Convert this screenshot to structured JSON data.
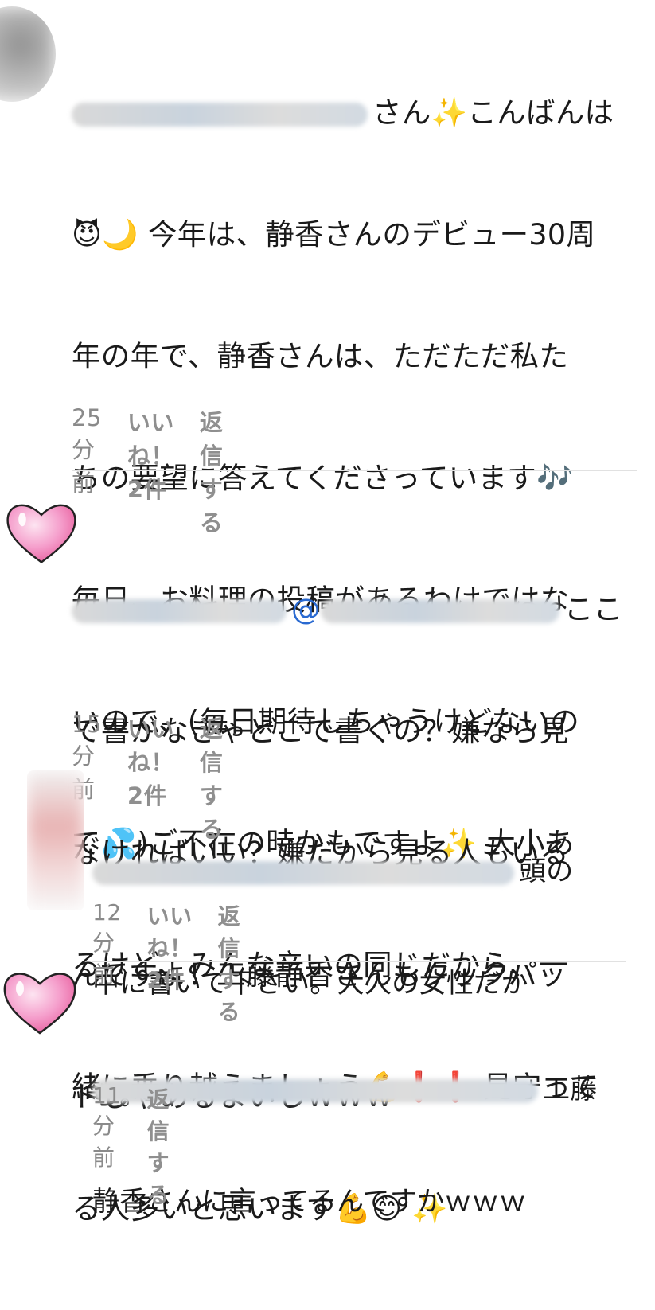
{
  "comments": [
    {
      "text_lines": [
        "さん✨こんばんは",
        "😈🌙 今年は、静香さんのデビュー30周",
        "年の年で、静香さんは、ただただ私た",
        "ちの要望に答えてくださっています🎶",
        "毎日、お料理の投稿があるわけではな",
        "いので、(毎日期待しちゃうけどないの",
        "で💦)ご不在の時かもですよ✨ 大小あ",
        "るけど、みんな辛いの同じだから、一",
        "緒に乗り越えましょう💪❗❗ 見守って",
        "る人多いと思います💪😊 ✨"
      ],
      "time": "25分前",
      "like": "いいね！2件",
      "reply": "返信する"
    },
    {
      "mention": "@",
      "first_line_tail": "ここ",
      "text_lines": [
        "で書かなきゃどこで書くの？嫌なら見",
        "なければいい？嫌だから見る人もいる",
        "んですよ！工藤静香さんもクックパッ",
        "ドじゃあるまいしｗｗｗ"
      ],
      "time": "15分前",
      "like": "いいね！2件",
      "reply": "返信する"
    },
    {
      "first_line_tail": "頭の",
      "text_lines": [
        "中に書いて下さい。大人の女性だか",
        "ら。"
      ],
      "time": "12分前",
      "like": "いいね！2件",
      "reply": "返信する"
    },
    {
      "first_line_tail": "工藤",
      "text_lines": [
        "静香さんに言ってるんですかｗｗｗ"
      ],
      "time": "11分前",
      "reply": "返信する"
    }
  ],
  "colors": {
    "text": "#1a1a1a",
    "meta": "#8a8a8a",
    "heart": "#f28ac0",
    "divider": "#e1e1e1"
  },
  "icons": [
    "heart-avatar-icon",
    "sparkle-icon",
    "moon-icon",
    "devil-icon",
    "music-note-icon",
    "sweat-icon",
    "muscle-icon",
    "exclamation-icon",
    "smile-icon"
  ]
}
